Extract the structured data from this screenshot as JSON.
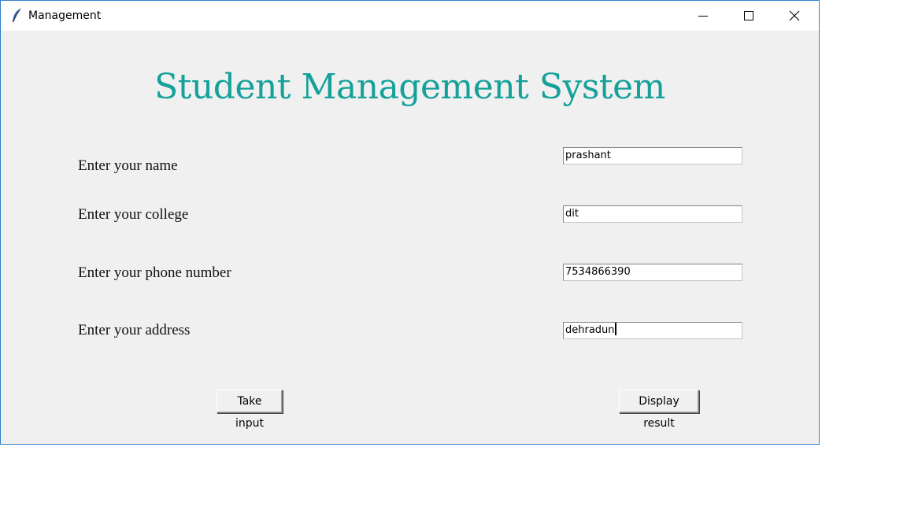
{
  "window": {
    "title": "Management",
    "icon": "feather-icon",
    "controls": [
      "minimize-icon",
      "maximize-icon",
      "close-icon"
    ]
  },
  "heading": "Student Management System",
  "form": {
    "fields": [
      {
        "label": "Enter your name",
        "value": "prashant"
      },
      {
        "label": "Enter your college",
        "value": "dit"
      },
      {
        "label": "Enter your phone number",
        "value": "7534866390"
      },
      {
        "label": "Enter your address",
        "value": "dehradun"
      }
    ]
  },
  "buttons": {
    "take_input": "Take input",
    "display_result": "Display result"
  },
  "colors": {
    "heading": "#15a19a",
    "window_border": "#2f7fc8",
    "background": "#f0f0f0"
  }
}
